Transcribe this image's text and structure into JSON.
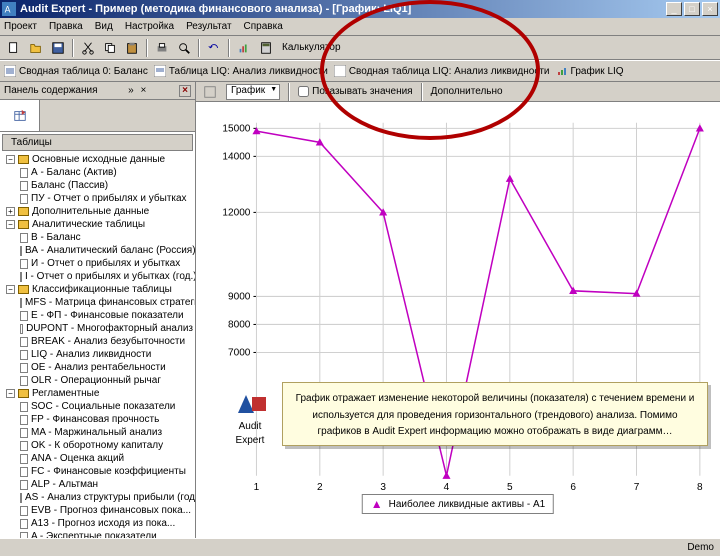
{
  "titlebar": {
    "title": "Audit Expert - Пример (методика финансового анализа) - [График: LIQ1]"
  },
  "menu": [
    "Проект",
    "Правка",
    "Вид",
    "Настройка",
    "Результат",
    "Справка"
  ],
  "toolbar": {
    "calculator_label": "Калькулятор"
  },
  "tabs": [
    {
      "label": "Сводная таблица 0: Баланс"
    },
    {
      "label": "Таблица LIQ: Анализ ликвидности"
    },
    {
      "label": "Сводная таблица LIQ: Анализ ликвидности"
    },
    {
      "label": "График LIQ"
    }
  ],
  "sidepanel": {
    "title": "Панель содержания",
    "tree_header": "Таблицы",
    "groups": [
      {
        "label": "Основные исходные данные",
        "expanded": true,
        "items": [
          {
            "label": "А - Баланс (Актив)"
          },
          {
            "label": "Баланс (Пассив)"
          },
          {
            "label": "ПУ - Отчет о прибылях и убытках"
          }
        ]
      },
      {
        "label": "Дополнительные данные",
        "expanded": false,
        "items": []
      },
      {
        "label": "Аналитические таблицы",
        "expanded": true,
        "items": [
          {
            "label": "В - Баланс"
          },
          {
            "label": "ВА - Аналитический баланс (Россия)"
          },
          {
            "label": "И - Отчет о прибылях и убытках"
          },
          {
            "label": "I - Отчет о прибылях и убытках (год.)"
          }
        ]
      },
      {
        "label": "Классификационные таблицы",
        "expanded": true,
        "items": [
          {
            "label": "MFS - Матрица финансовых стратегий"
          },
          {
            "label": "Е - ФП - Финансовые показатели"
          },
          {
            "label": "DUPONT - Многофакторный анализ"
          },
          {
            "label": "BREAK - Анализ безубыточности"
          },
          {
            "label": "LIQ - Анализ ликвидности"
          },
          {
            "label": "OE - Анализ рентабельности"
          },
          {
            "label": "OLR - Операционный рычаг"
          }
        ]
      },
      {
        "label": "Регламентные",
        "expanded": true,
        "items": [
          {
            "label": "SOC - Социальные показатели"
          },
          {
            "label": "FP - Финансовая прочность"
          },
          {
            "label": "MA - Маржинальный анализ"
          },
          {
            "label": "OK - К оборотному капиталу"
          },
          {
            "label": "ANA - Оценка акций"
          },
          {
            "label": "FC - Финансовые коэффициенты"
          },
          {
            "label": "ALP - Альтман"
          },
          {
            "label": "AS - Анализ структуры прибыли (год.)"
          },
          {
            "label": "EVB - Прогноз финансовых пока..."
          },
          {
            "label": "A13 - Прогноз исходя из пока..."
          },
          {
            "label": "A - Экспертные показатели"
          }
        ]
      }
    ]
  },
  "chartbar": {
    "dropdown_value": "График",
    "show_values": "Показывать значения",
    "additional": "Дополнительно"
  },
  "callout": {
    "logo_text": "Audit Expert",
    "text": "График отражает изменение некоторой величины (показателя) с течением времени и используется для проведения горизонтального (трендового) анализа. Помимо графиков в Audit Expert информацию можно отображать в виде диаграмм…"
  },
  "statusbar": {
    "demo": "Demo"
  },
  "chart_data": {
    "type": "line",
    "title": "",
    "xlabel": "",
    "ylabel": "",
    "ylim": [
      2600,
      15200
    ],
    "y_ticks": [
      7000,
      8000,
      9000,
      12000,
      14000,
      15000
    ],
    "x": [
      1,
      2,
      3,
      4,
      5,
      6,
      7,
      8
    ],
    "series": [
      {
        "name": "Наиболее ликвидные активы - А1",
        "color": "#c000c0",
        "values": [
          14900,
          14500,
          12000,
          2600,
          13200,
          9200,
          9100,
          15000
        ]
      }
    ]
  },
  "legend_label": "Наиболее ликвидные активы - А1"
}
